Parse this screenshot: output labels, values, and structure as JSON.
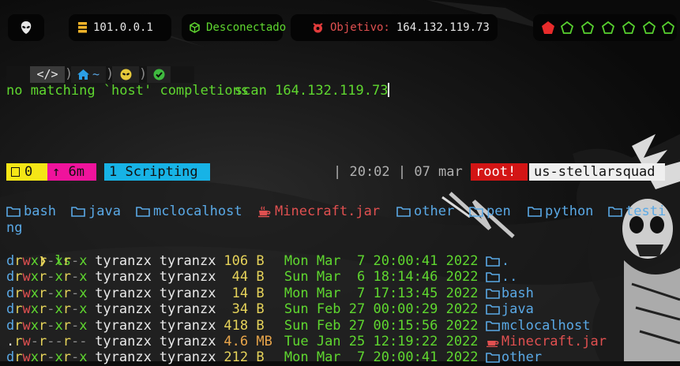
{
  "topbar": {
    "ip": "101.0.0.1",
    "connection": "Desconectado",
    "target_label": "Objetivo:",
    "target_value": "164.132.119.73"
  },
  "prompt": {
    "code_icon": "</>",
    "home_tilde": "~",
    "command": "scan",
    "arg": "164.132.119.73",
    "output": "no matching `host' completions"
  },
  "status": {
    "window_count": "0",
    "uptime": "↑ 6m",
    "session": "1 Scripting",
    "time": "| 20:02 | 07 mar",
    "user": "root!",
    "host": "us-stellarsquad"
  },
  "dirs": [
    "bash",
    "java",
    "mclocalhost",
    "Minecraft.jar",
    "other",
    "pen",
    "python",
    "testi"
  ],
  "dirs_wrap": "ng",
  "ls_prompt": "❯",
  "ls_cmd": "ls",
  "ls": [
    {
      "perm": "drwxr-xr-x",
      "user": "tyranzx",
      "group": "tyranzx",
      "size": "106",
      "unit": "B",
      "date": "Mon Mar  7 20:00:41 2022",
      "name": "."
    },
    {
      "perm": "drwxr-xr-x",
      "user": "tyranzx",
      "group": "tyranzx",
      "size": "44",
      "unit": "B",
      "date": "Sun Mar  6 18:14:46 2022",
      "name": ".."
    },
    {
      "perm": "drwxr-xr-x",
      "user": "tyranzx",
      "group": "tyranzx",
      "size": "14",
      "unit": "B",
      "date": "Mon Mar  7 17:13:45 2022",
      "name": "bash"
    },
    {
      "perm": "drwxr-xr-x",
      "user": "tyranzx",
      "group": "tyranzx",
      "size": "34",
      "unit": "B",
      "date": "Sun Feb 27 00:00:29 2022",
      "name": "java"
    },
    {
      "perm": "drwxr-xr-x",
      "user": "tyranzx",
      "group": "tyranzx",
      "size": "418",
      "unit": "B",
      "date": "Sun Feb 27 00:15:56 2022",
      "name": "mclocalhost"
    },
    {
      "perm": ".rw-r--r--",
      "user": "tyranzx",
      "group": "tyranzx",
      "size": "4.6",
      "unit": "MB",
      "date": "Tue Jan 25 12:19:22 2022",
      "name": "Minecraft.jar"
    },
    {
      "perm": "drwxr-xr-x",
      "user": "tyranzx",
      "group": "tyranzx",
      "size": "212",
      "unit": "B",
      "date": "Mon Mar  7 20:00:41 2022",
      "name": "other"
    }
  ],
  "colors": {
    "green": "#5fd72f",
    "cyan": "#5aa9e6",
    "yellow": "#e6d35a",
    "red": "#e05050",
    "status_yellow": "#f5e616",
    "status_magenta": "#f0139c",
    "status_blue": "#17b3e6",
    "status_red": "#d31515"
  }
}
